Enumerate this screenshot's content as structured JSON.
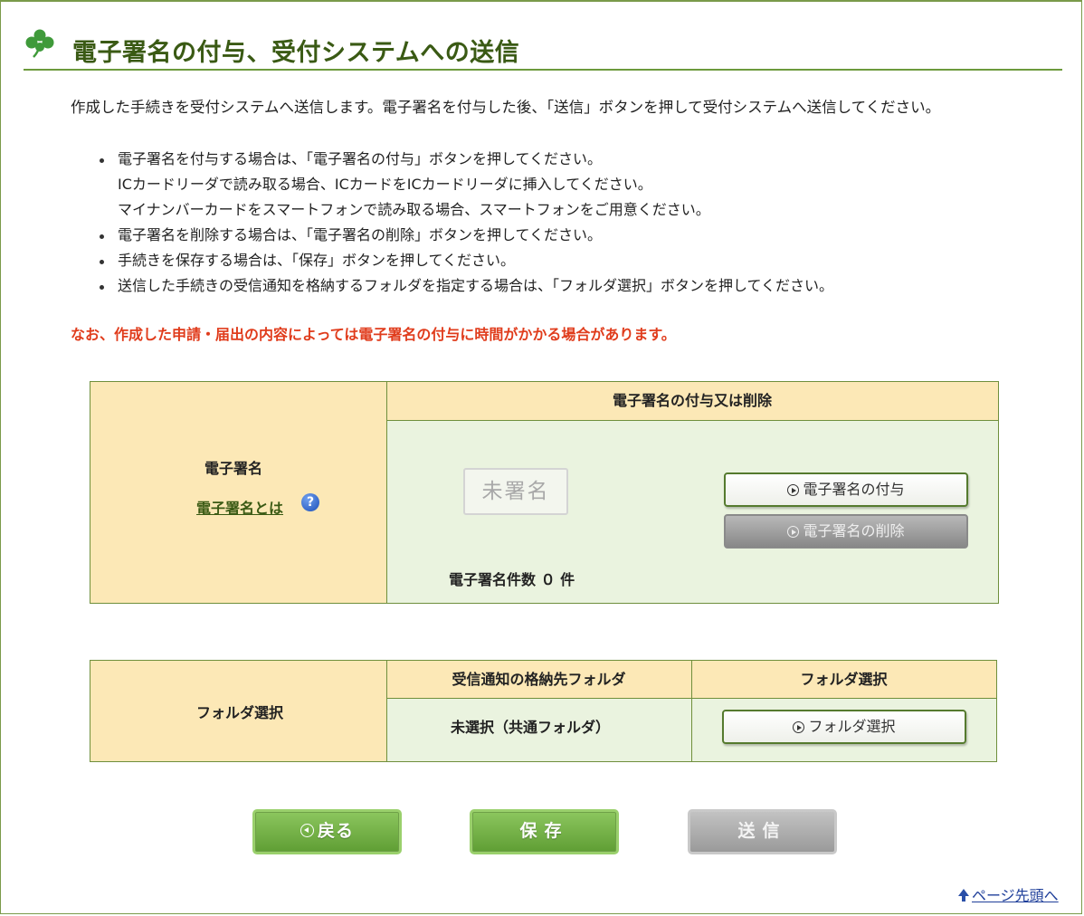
{
  "header": {
    "title": "電子署名の付与、受付システムへの送信",
    "icon": "clover-icon"
  },
  "intro": "作成した手続きを受付システムへ送信します。電子署名を付与した後、「送信」ボタンを押して受付システムへ送信してください。",
  "notes": [
    "電子署名を付与する場合は、「電子署名の付与」ボタンを押してください。",
    "ICカードリーダで読み取る場合、ICカードをICカードリーダに挿入してください。",
    "マイナンバーカードをスマートフォンで読み取る場合、スマートフォンをご用意ください。",
    "電子署名を削除する場合は、「電子署名の削除」ボタンを押してください。",
    "手続きを保存する場合は、「保存」ボタンを押してください。",
    "送信した手続きの受信通知を格納するフォルダを指定する場合は、「フォルダ選択」ボタンを押してください。"
  ],
  "warning": "なお、作成した申請・届出の内容によっては電子署名の付与に時間がかかる場合があります。",
  "signature_table": {
    "row_label": "電子署名",
    "help_link": "電子署名とは",
    "help_icon": "?",
    "column_header": "電子署名の付与又は削除",
    "stamp": "未署名",
    "count_text": "電子署名件数 ０ 件",
    "add_button": "電子署名の付与",
    "delete_button": "電子署名の削除"
  },
  "folder_table": {
    "row_label": "フォルダ選択",
    "col1_header": "受信通知の格納先フォルダ",
    "col2_header": "フォルダ選択",
    "current_folder": "未選択（共通フォルダ）",
    "select_button": "フォルダ選択"
  },
  "actions": {
    "back": "戻る",
    "save": "保存",
    "send": "送信"
  },
  "page_top_link": "ページ先頭へ",
  "colors": {
    "accent_green": "#6c9a3c",
    "header_fill": "#fce8b6",
    "body_fill": "#eaf3df",
    "warning_red": "#e03c1c"
  }
}
